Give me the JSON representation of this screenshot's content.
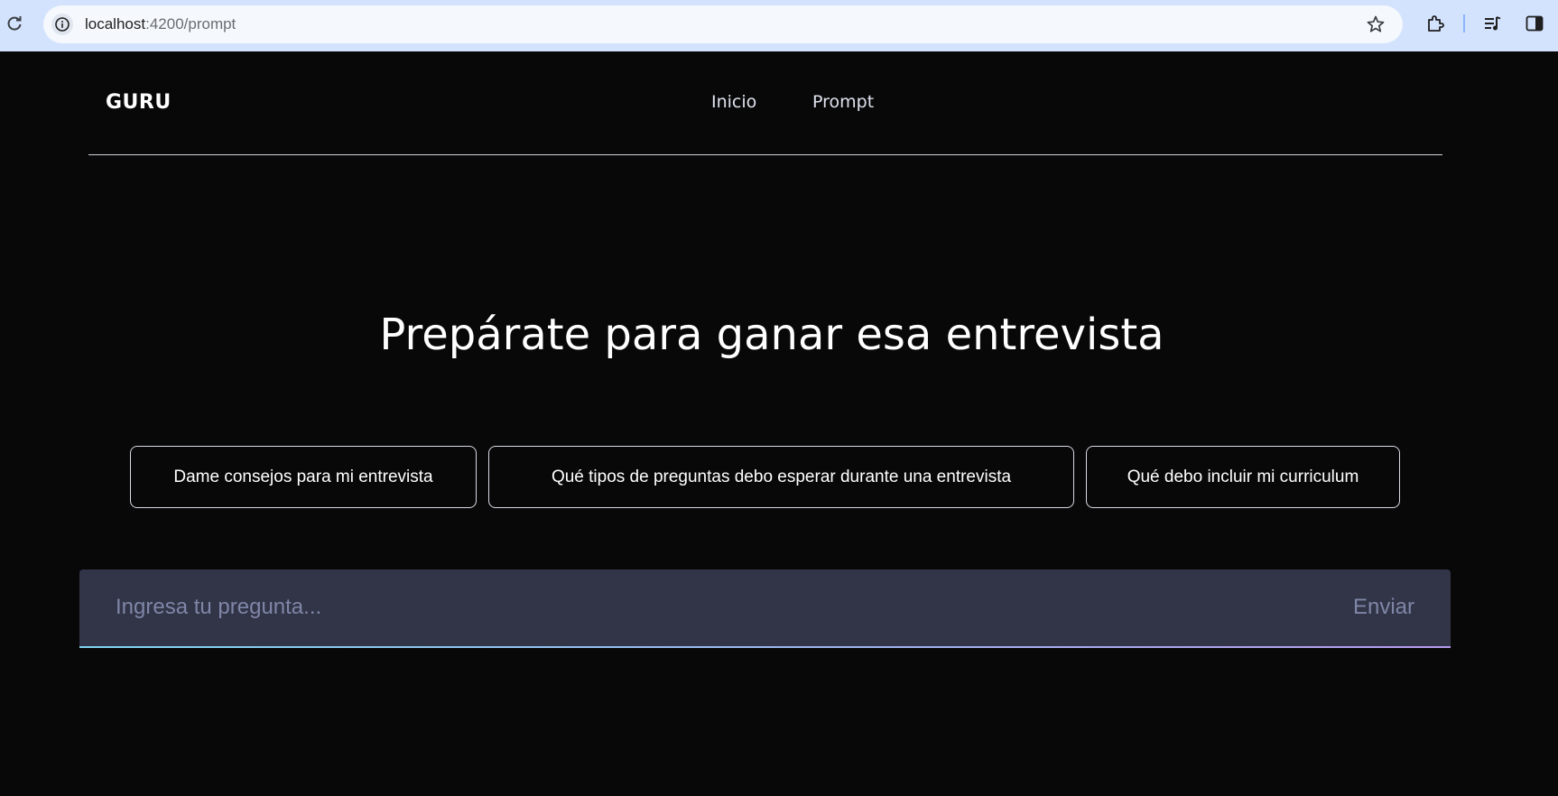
{
  "browser": {
    "url_host": "localhost",
    "url_path": ":4200/prompt",
    "icons": [
      "reload-icon",
      "site-info-icon",
      "bookmark-star-icon",
      "extensions-icon",
      "media-controls-icon",
      "side-panel-icon"
    ]
  },
  "header": {
    "logo": "GURU",
    "nav": [
      {
        "label": "Inicio"
      },
      {
        "label": "Prompt"
      }
    ]
  },
  "main": {
    "title": "Prepárate para ganar esa entrevista",
    "suggestions": [
      {
        "label": "Dame consejos para mi entrevista"
      },
      {
        "label": "Qué tipos de preguntas debo esperar durante una entrevista"
      },
      {
        "label": "Qué debo incluir mi curriculum"
      }
    ],
    "prompt": {
      "value": "",
      "placeholder": "Ingresa tu pregunta...",
      "send_label": "Enviar"
    }
  },
  "colors": {
    "background": "#080809",
    "prompt_bar": "#323548",
    "accent_gradient_start": "#7fd4f0",
    "accent_gradient_end": "#b79af0"
  }
}
